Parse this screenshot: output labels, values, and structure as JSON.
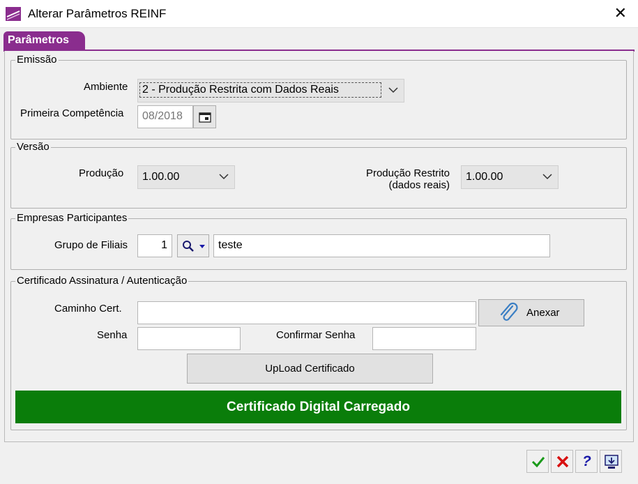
{
  "window": {
    "title": "Alterar Parâmetros REINF",
    "close_glyph": "✕"
  },
  "tab": {
    "label": "Parâmetros"
  },
  "emissao": {
    "legend": "Emissão",
    "ambiente_label": "Ambiente",
    "ambiente_value": "2 - Produção Restrita com Dados Reais",
    "competencia_label": "Primeira Competência",
    "competencia_value": "08/2018"
  },
  "versao": {
    "legend": "Versão",
    "producao_label": "Produção",
    "producao_value": "1.00.00",
    "restrito_label_line1": "Produção Restrito",
    "restrito_label_line2": "(dados reais)",
    "restrito_value": "1.00.00"
  },
  "empresas": {
    "legend": "Empresas Participantes",
    "grupo_label": "Grupo de Filiais",
    "grupo_code": "1",
    "grupo_name": "teste"
  },
  "certificado": {
    "legend": "Certificado Assinatura / Autenticação",
    "caminho_label": "Caminho Cert.",
    "caminho_value": "",
    "anexar_label": "Anexar",
    "senha_label": "Senha",
    "senha_value": "",
    "confirmar_label": "Confirmar Senha",
    "confirmar_value": "",
    "upload_label": "UpLoad Certificado",
    "status_text": "Certificado Digital Carregado"
  },
  "toolbar": {
    "help_glyph": "?"
  },
  "colors": {
    "tab": "#8a2d8e",
    "status_bar": "#0a7d0a",
    "confirm": "#1a9a1a",
    "cancel": "#d81010",
    "help": "#1a1aa8"
  }
}
